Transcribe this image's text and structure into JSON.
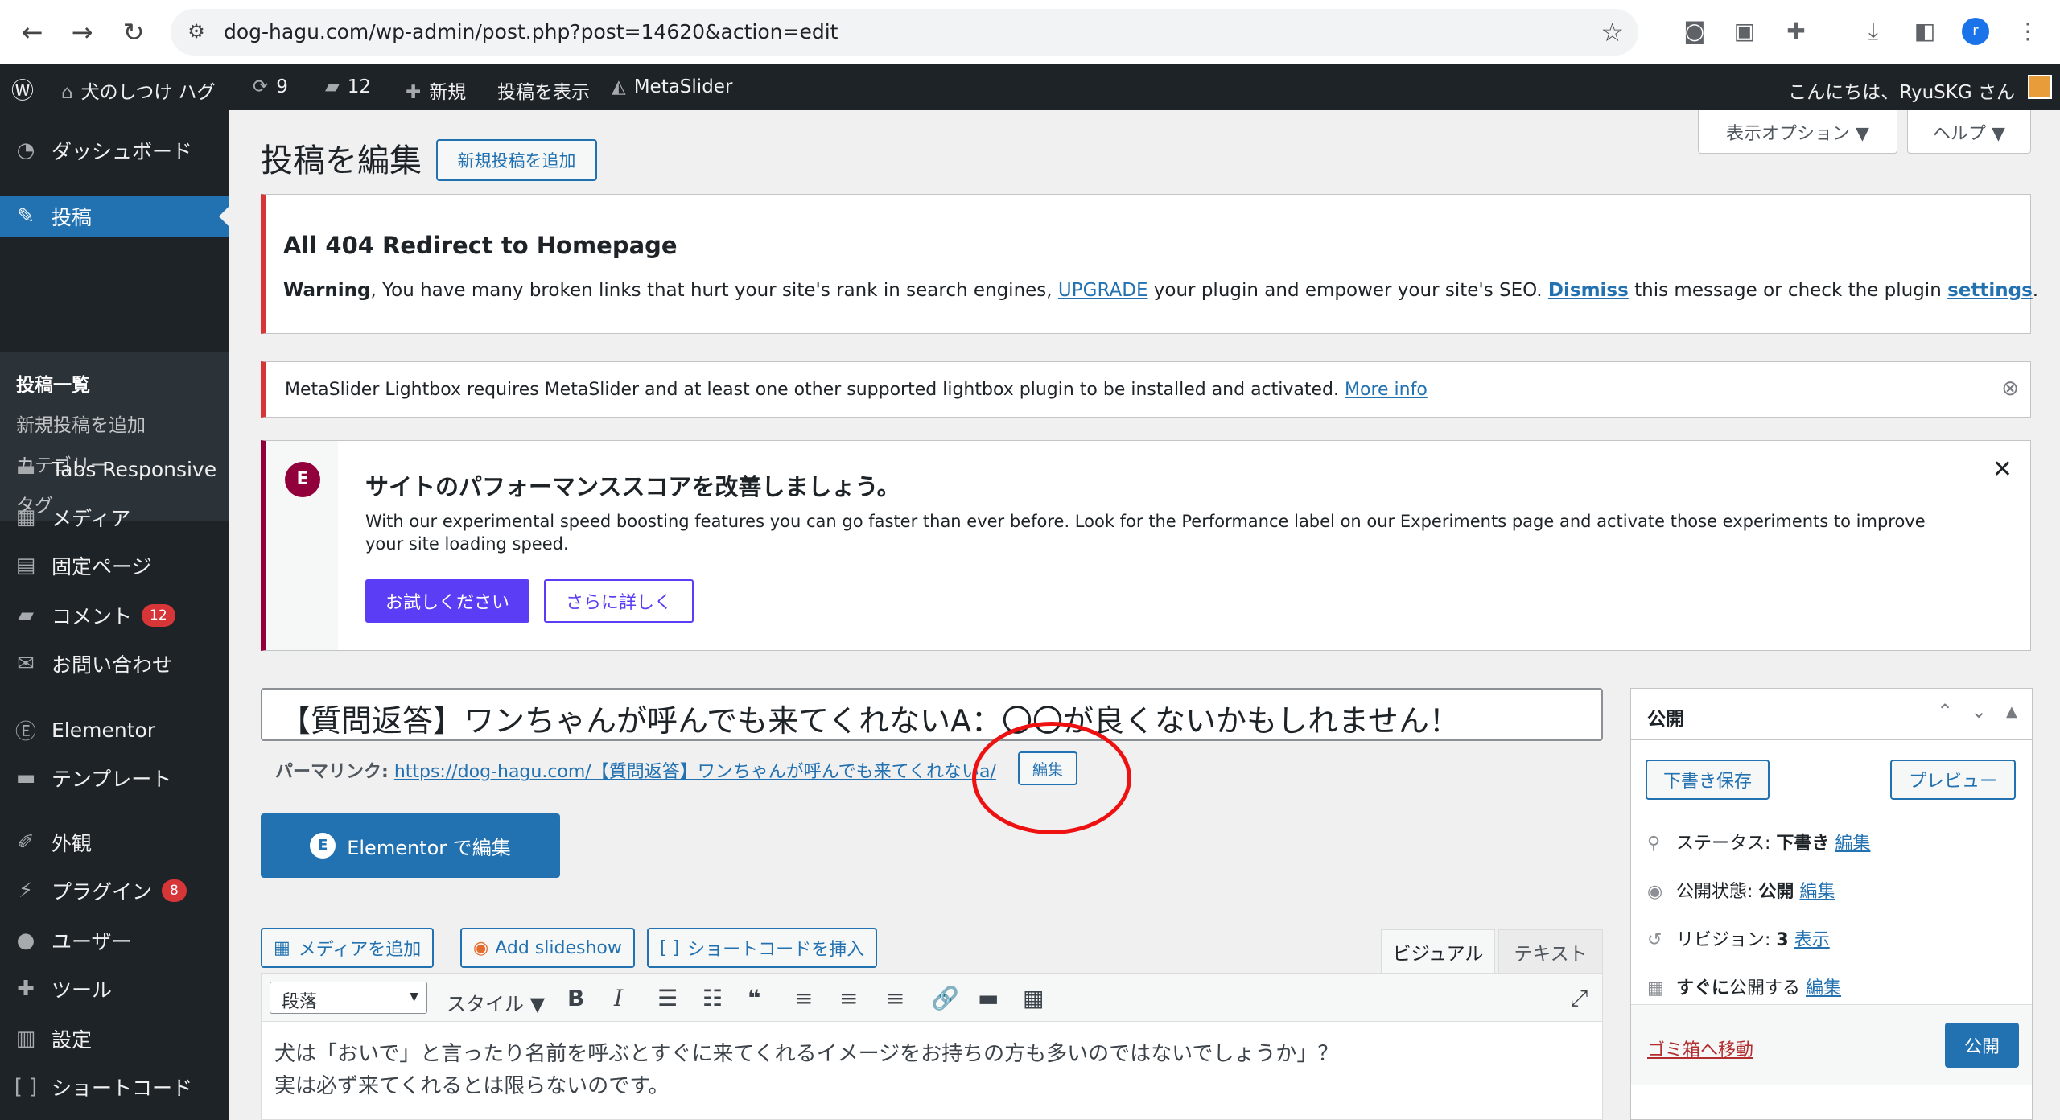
{
  "browser": {
    "url": "dog-hagu.com/wp-admin/post.php?post=14620&action=edit",
    "profile_initial": "r"
  },
  "adminbar": {
    "site_name": "犬のしつけ ハグ",
    "updates_count": "9",
    "comments_count": "12",
    "new_label": "新規",
    "view_post_label": "投稿を表示",
    "metaslider_label": "MetaSlider",
    "greeting": "こんにちは、RyuSKG さん"
  },
  "sidebar": {
    "dashboard": "ダッシュボード",
    "posts": "投稿",
    "submenu": [
      "投稿一覧",
      "新規投稿を追加",
      "カテゴリー",
      "タグ"
    ],
    "tabs_responsive": "Tabs Responsive",
    "media": "メディア",
    "pages": "固定ページ",
    "comments": "コメント",
    "comments_badge": "12",
    "contact": "お問い合わせ",
    "elementor": "Elementor",
    "templates": "テンプレート",
    "appearance": "外観",
    "plugins": "プラグイン",
    "plugins_badge": "8",
    "users": "ユーザー",
    "tools": "ツール",
    "settings": "設定",
    "shortcode": "ショートコード"
  },
  "header": {
    "title": "投稿を編集",
    "add_new": "新規投稿を追加",
    "screen_options": "表示オプション ▼",
    "help": "ヘルプ ▼"
  },
  "notice_404": {
    "title": "All 404 Redirect to Homepage",
    "warning_bold": "Warning",
    "text1": ", You have many broken links that hurt your site's rank in search engines, ",
    "upgrade": "UPGRADE",
    "text2": " your plugin and empower your site's SEO.  ",
    "dismiss": "Dismiss",
    "text3": " this message or check the plugin ",
    "settings": "settings",
    "text4": "."
  },
  "notice_metaslider": {
    "text": "MetaSlider Lightbox requires MetaSlider and at least one other supported lightbox plugin to be installed and activated. ",
    "more_info": "More info"
  },
  "notice_perf": {
    "title": "サイトのパフォーマンススコアを改善しましょう。",
    "body": "With our experimental speed boosting features you can go faster than ever before. Look for the Performance label on our Experiments page and activate those experiments to improve your site loading speed.",
    "try_button": "お試しください",
    "learn_button": "さらに詳しく"
  },
  "post": {
    "title": "【質問返答】ワンちゃんが呼んでも来てくれないA：〇〇が良くないかもしれません！",
    "permalink_label": "パーマリンク:",
    "permalink_url": "https://dog-hagu.com/【質問返答】ワンちゃんが呼んでも来てくれないa/",
    "permalink_edit": "編集",
    "elementor_button": "Elementor で編集"
  },
  "media_buttons": {
    "add_media": "メディアを追加",
    "add_slideshow": "Add slideshow",
    "insert_shortcode": "ショートコードを挿入"
  },
  "editor": {
    "tab_visual": "ビジュアル",
    "tab_text": "テキスト",
    "format_select": "段落",
    "style_label": "スタイル ▼",
    "body_line1": "犬は「おいで」と言ったり名前を呼ぶとすぐに来てくれるイメージをお持ちの方も多いのではないでしょうか」？",
    "body_line2": "実は必ず来てくれるとは限らないのです。"
  },
  "publish_box": {
    "title": "公開",
    "save_draft": "下書き保存",
    "preview": "プレビュー",
    "status_label": "ステータス: ",
    "status_value": "下書き",
    "visibility_label": "公開状態: ",
    "visibility_value": "公開",
    "revisions_label": "リビジョン: ",
    "revisions_value": "3",
    "revisions_link": "表示",
    "schedule_bold": "すぐに",
    "schedule_text": "公開する",
    "edit_link": "編集",
    "trash": "ゴミ箱へ移動",
    "publish": "公開"
  },
  "colors": {
    "admin_dark": "#1d2327",
    "primary": "#2271b1",
    "badge_red": "#d63638",
    "elementor": "#92003b",
    "perf_button": "#5b3df5",
    "annotation_circle": "#e11111"
  }
}
